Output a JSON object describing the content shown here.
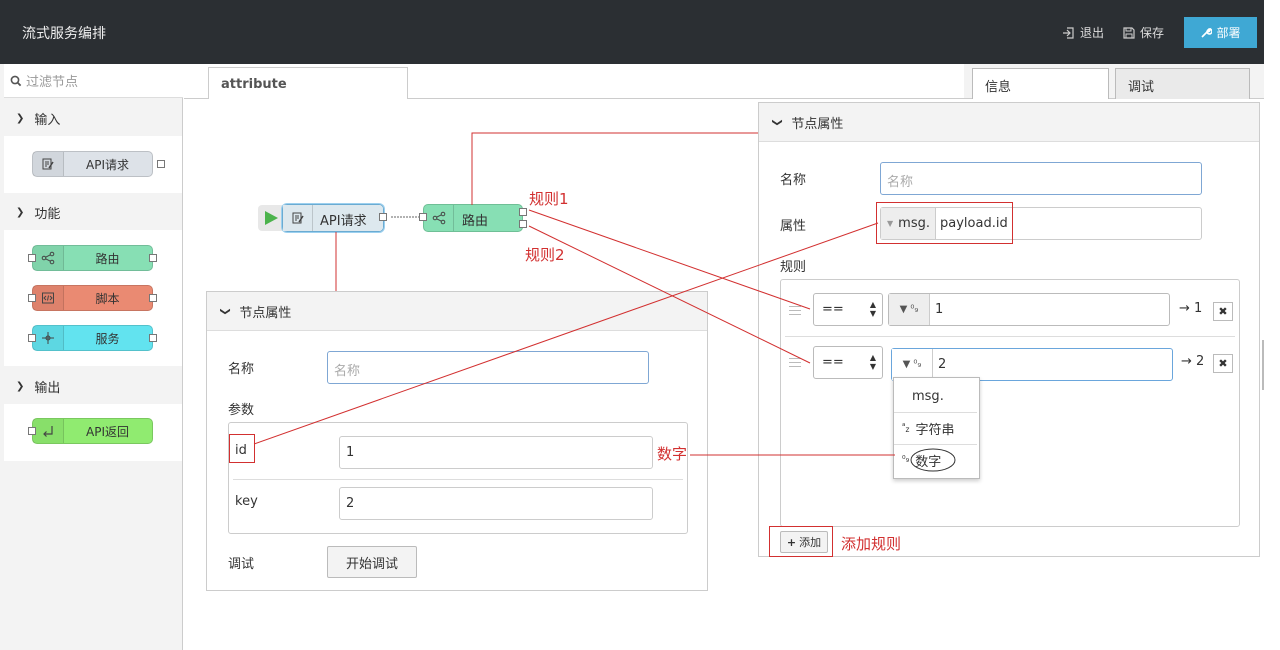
{
  "header": {
    "title": "流式服务编排",
    "logout": "退出",
    "save": "保存",
    "deploy": "部署"
  },
  "palette": {
    "filter_placeholder": "过滤节点",
    "categories": [
      {
        "label": "输入",
        "nodes": [
          {
            "label": "API请求",
            "color": "#dde2e8"
          }
        ]
      },
      {
        "label": "功能",
        "nodes": [
          {
            "label": "路由",
            "color": "#87dfb4"
          },
          {
            "label": "脚本",
            "color": "#ea8a72"
          },
          {
            "label": "服务",
            "color": "#62e3ef"
          }
        ]
      },
      {
        "label": "输出",
        "nodes": [
          {
            "label": "API返回",
            "color": "#90eb70"
          }
        ]
      }
    ]
  },
  "workspace": {
    "tab": "attribute",
    "flow_nodes": [
      {
        "label": "API请求",
        "color": "#dde8ee"
      },
      {
        "label": "路由",
        "color": "#87dfb4"
      }
    ]
  },
  "left_panel": {
    "header": "节点属性",
    "name_label": "名称",
    "name_placeholder": "名称",
    "params_label": "参数",
    "params": [
      {
        "key": "id",
        "value": "1"
      },
      {
        "key": "key",
        "value": "2"
      }
    ],
    "debug_label": "调试",
    "debug_button": "开始调试"
  },
  "right_panel": {
    "tabs": [
      "信息",
      "调试"
    ],
    "header": "节点属性",
    "name_label": "名称",
    "name_placeholder": "名称",
    "property_label": "属性",
    "property_prefix": "msg.",
    "property_value": "payload.id",
    "rules_label": "规则",
    "rules": [
      {
        "op": "==",
        "value": "1",
        "output": "→ 1"
      },
      {
        "op": "==",
        "value": "2",
        "output": "→ 2"
      }
    ],
    "dropdown": {
      "options": [
        {
          "icon": "",
          "label": "msg."
        },
        {
          "icon": "az",
          "label": "字符串"
        },
        {
          "icon": "09",
          "label": "数字"
        }
      ]
    },
    "add_button": "添加"
  },
  "annotations": {
    "rule1": "规则1",
    "rule2": "规则2",
    "number": "数字",
    "add_rule": "添加规则"
  },
  "colors": {
    "header_bg": "#2b2f33",
    "deploy_bg": "#3fa8d4",
    "annotation_red": "#d23030"
  }
}
